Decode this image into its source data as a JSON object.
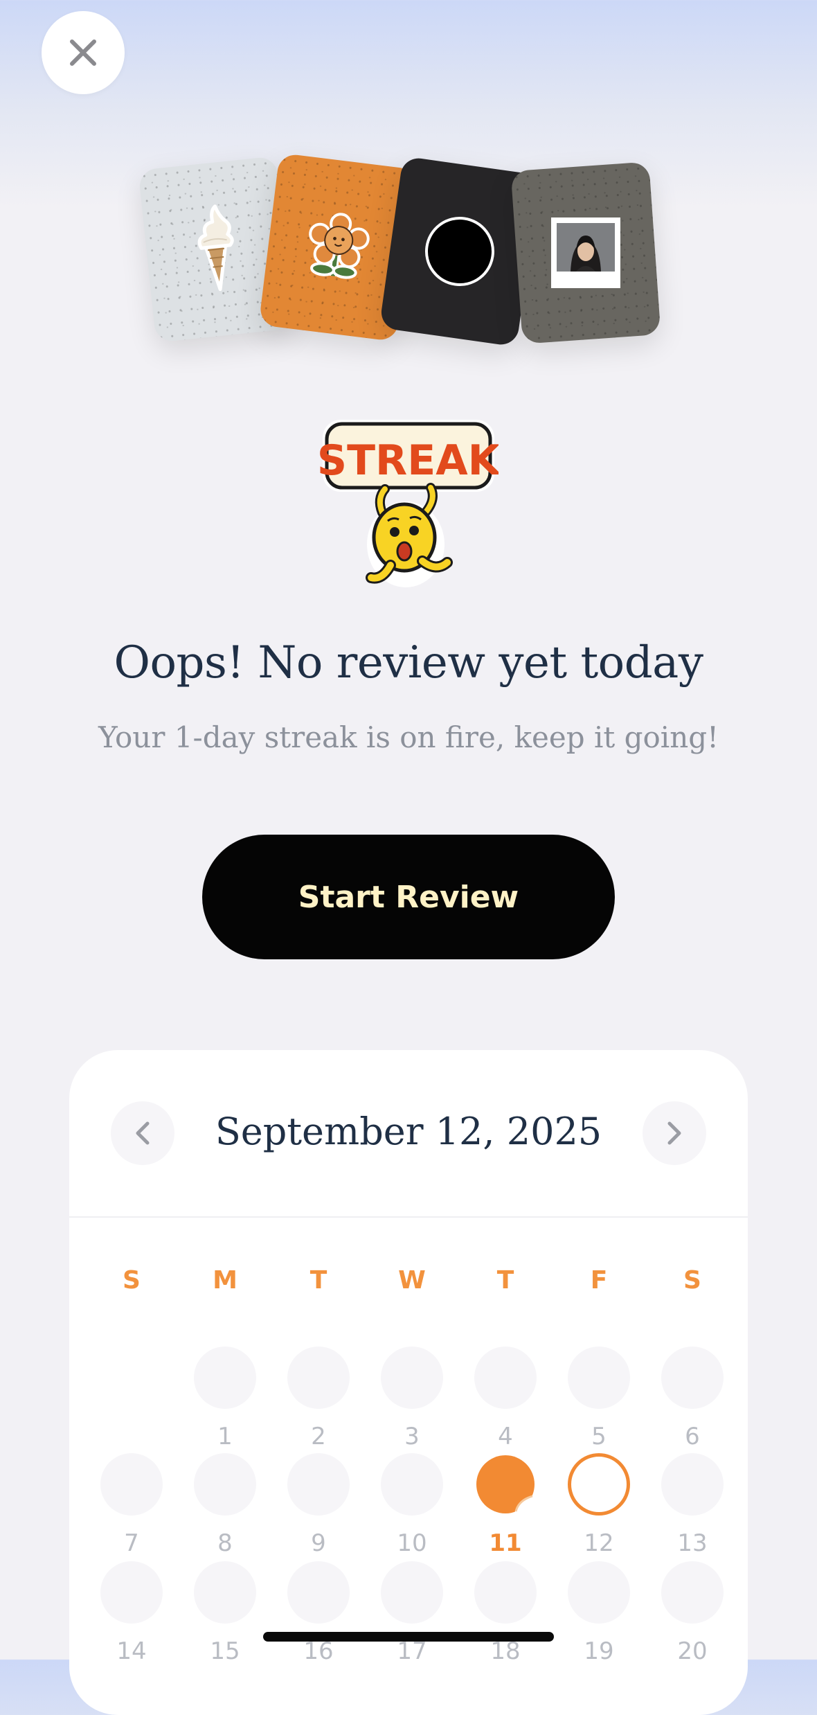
{
  "header": {
    "close_icon": "close-icon"
  },
  "cards": [
    {
      "icon": "ice-cream-sticker",
      "color": "#dde1e4"
    },
    {
      "icon": "flower-sticker",
      "color": "#e28734"
    },
    {
      "icon": "black-circle-sticker",
      "color": "#262527"
    },
    {
      "icon": "polaroid-photo-sticker",
      "color": "#686660"
    }
  ],
  "streak_sticker": {
    "label": "STREAK",
    "color": "#e24a1c"
  },
  "headline": "Oops! No review yet today",
  "subline": "Your 1-day streak is on fire, keep it going!",
  "start_button": {
    "label": "Start Review",
    "text_color": "#fff2c6"
  },
  "calendar": {
    "month_label": "September 12, 2025",
    "prev_icon": "chevron-left-icon",
    "next_icon": "chevron-right-icon",
    "weekdays": [
      "S",
      "M",
      "T",
      "W",
      "T",
      "F",
      "S"
    ],
    "weeks": [
      [
        "",
        "1",
        "2",
        "3",
        "4",
        "5",
        "6"
      ],
      [
        "7",
        "8",
        "9",
        "10",
        "11",
        "12",
        "13"
      ],
      [
        "14",
        "15",
        "16",
        "17",
        "18",
        "19",
        "20"
      ]
    ],
    "completed_day": "11",
    "selected_day": "12",
    "accent": "#f28a33"
  },
  "colors": {
    "accent": "#f28a33",
    "title": "#1f2f45",
    "muted": "#8c919b"
  }
}
